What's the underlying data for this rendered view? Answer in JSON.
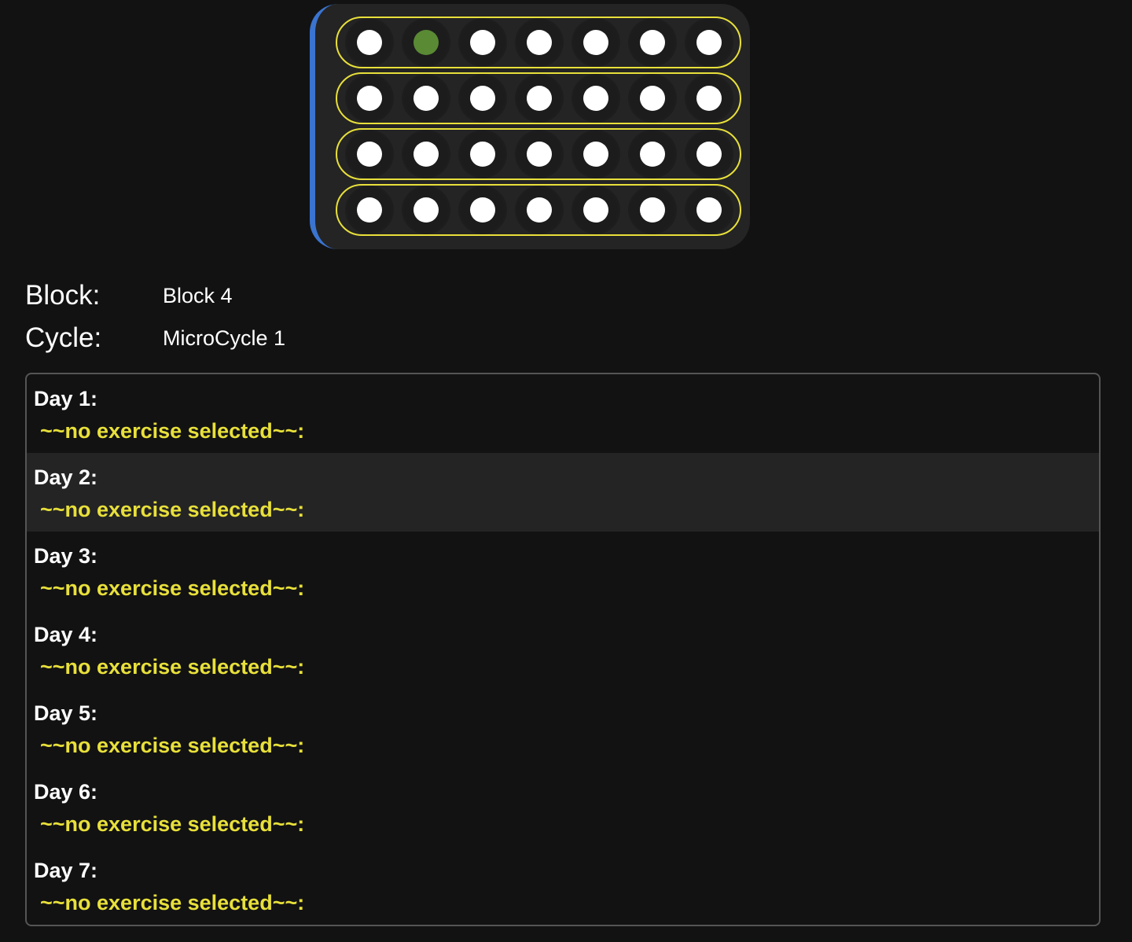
{
  "calendar": {
    "accent_colors": {
      "left_bar": "#3a74d0",
      "week_outline": "#e8e03a",
      "selected_day": "#5a8a34",
      "day": "#ffffff"
    },
    "weeks": [
      {
        "days": [
          false,
          true,
          false,
          false,
          false,
          false,
          false
        ]
      },
      {
        "days": [
          false,
          false,
          false,
          false,
          false,
          false,
          false
        ]
      },
      {
        "days": [
          false,
          false,
          false,
          false,
          false,
          false,
          false
        ]
      },
      {
        "days": [
          false,
          false,
          false,
          false,
          false,
          false,
          false
        ]
      }
    ]
  },
  "info": {
    "block_label": "Block:",
    "block_value": "Block 4",
    "cycle_label": "Cycle:",
    "cycle_value": "MicroCycle 1"
  },
  "days": [
    {
      "title": "Day 1:",
      "exercise": "~~no exercise selected~~:"
    },
    {
      "title": "Day 2:",
      "exercise": "~~no exercise selected~~:"
    },
    {
      "title": "Day 3:",
      "exercise": "~~no exercise selected~~:"
    },
    {
      "title": "Day 4:",
      "exercise": "~~no exercise selected~~:"
    },
    {
      "title": "Day 5:",
      "exercise": "~~no exercise selected~~:"
    },
    {
      "title": "Day 6:",
      "exercise": "~~no exercise selected~~:"
    },
    {
      "title": "Day 7:",
      "exercise": "~~no exercise selected~~:"
    }
  ]
}
